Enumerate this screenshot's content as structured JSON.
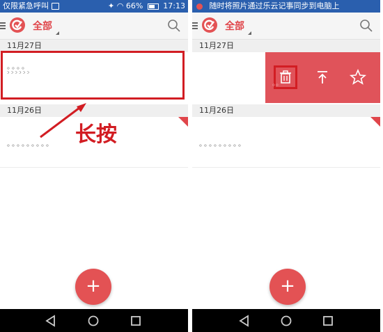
{
  "left": {
    "status": {
      "carrier": "仅限紧急呼叫",
      "battery": "66%",
      "time": "17:13"
    },
    "filter_label": "全部",
    "sections": [
      {
        "date": "11月27日",
        "lines": [
          "。。。。",
          "ᵓᵓᵓᵓᵓᵓ"
        ]
      },
      {
        "date": "11月26日",
        "lines": [
          "。。。。。。。。。"
        ]
      }
    ],
    "annotation_text": "长按"
  },
  "right": {
    "notification": "随时将照片通过乐云记事同步到电脑上",
    "filter_label": "全部",
    "sections": [
      {
        "date": "11月27日",
        "faded": "。。"
      },
      {
        "date": "11月26日",
        "lines": [
          "。。。。。。。。。"
        ]
      }
    ],
    "actions": [
      "delete-icon",
      "move-to-top-icon",
      "star-icon"
    ]
  },
  "colors": {
    "accent": "#e35254",
    "status_bar": "#2a5fae",
    "highlight": "#d21d23"
  }
}
